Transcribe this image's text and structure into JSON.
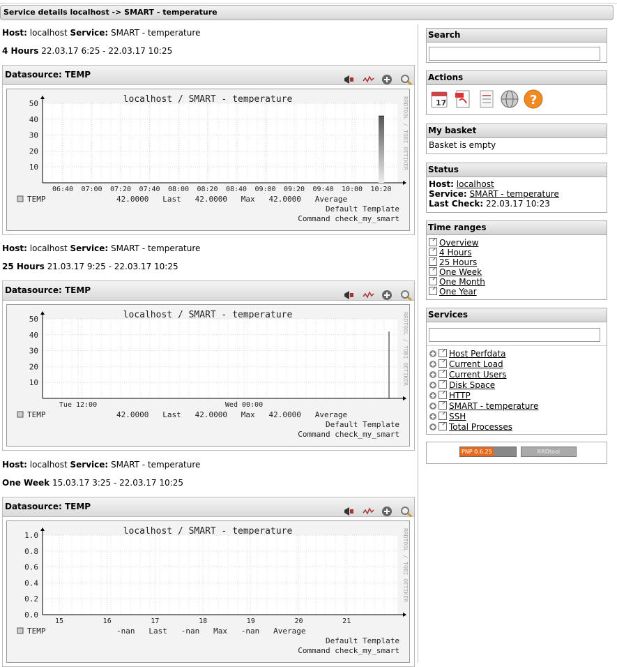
{
  "title": "Service details localhost -> SMART - temperature",
  "labels": {
    "host": "Host:",
    "service": "Service:"
  },
  "host_name": "localhost",
  "service_name": "SMART - temperature",
  "periods": [
    {
      "range_label": "4 Hours",
      "range_value": "22.03.17 6:25 - 22.03.17 10:25",
      "datasource": "Datasource: TEMP",
      "graph_title": "localhost / SMART - temperature",
      "side_text": "RRDTOOL / TOBI OETIKER",
      "y_ticks": [
        "50",
        "40",
        "30",
        "20",
        "10"
      ],
      "x_ticks": [
        "06:40",
        "07:00",
        "07:20",
        "07:40",
        "08:00",
        "08:20",
        "08:40",
        "09:00",
        "09:20",
        "09:40",
        "10:00",
        "10:20"
      ],
      "legend_name": "TEMP",
      "legend_stats": "42.0000   Last   42.0000   Max   42.0000   Average",
      "template_line": "Default Template",
      "command_line": "Command check_my_smart"
    },
    {
      "range_label": "25 Hours",
      "range_value": "21.03.17 9:25 - 22.03.17 10:25",
      "datasource": "Datasource: TEMP",
      "graph_title": "localhost / SMART - temperature",
      "side_text": "RRDTOOL / TOBI OETIKER",
      "y_ticks": [
        "50",
        "40",
        "30",
        "20",
        "10"
      ],
      "x_ticks": [
        "Tue 12:00",
        "Wed 00:00"
      ],
      "legend_name": "TEMP",
      "legend_stats": "42.0000   Last   42.0000   Max   42.0000   Average",
      "template_line": "Default Template",
      "command_line": "Command check_my_smart"
    },
    {
      "range_label": "One Week",
      "range_value": "15.03.17 3:25 - 22.03.17 10:25",
      "datasource": "Datasource: TEMP",
      "graph_title": "localhost / SMART - temperature",
      "side_text": "RRDTOOL / TOBI OETIKER",
      "y_ticks": [
        "1.0",
        "0.8",
        "0.6",
        "0.4",
        "0.2",
        "0.0"
      ],
      "x_ticks": [
        "15",
        "16",
        "17",
        "18",
        "19",
        "20",
        "21"
      ],
      "legend_name": "TEMP",
      "legend_stats": "-nan   Last   -nan   Max   -nan   Average",
      "template_line": "Default Template",
      "command_line": "Command check_my_smart"
    }
  ],
  "sidebar": {
    "search_title": "Search",
    "actions_title": "Actions",
    "action_icons": [
      "calendar-icon",
      "pdf-icon",
      "document-icon",
      "globe-icon",
      "help-icon"
    ],
    "basket_title": "My basket",
    "basket_text": "Basket is empty",
    "status_title": "Status",
    "status": {
      "host_label": "Host:",
      "host_value": "localhost",
      "service_label": "Service:",
      "service_value": "SMART - temperature",
      "check_label": "Last Check:",
      "check_value": "22.03.17 10:23"
    },
    "timeranges_title": "Time ranges",
    "timeranges": [
      "Overview",
      "4 Hours",
      "25 Hours",
      "One Week",
      "One Month",
      "One Year"
    ],
    "services_title": "Services",
    "services": [
      "Host Perfdata",
      "Current Load",
      "Current Users",
      "Disk Space",
      "HTTP",
      "SMART - temperature",
      "SSH",
      "Total Processes"
    ],
    "badges": [
      "PNP 0.6.25",
      "RRDtool"
    ]
  },
  "chart_data": [
    {
      "type": "area",
      "title": "localhost / SMART - temperature",
      "categories": [
        "06:40",
        "07:00",
        "07:20",
        "07:40",
        "08:00",
        "08:20",
        "08:40",
        "09:00",
        "09:20",
        "09:40",
        "10:00",
        "10:20"
      ],
      "series": [
        {
          "name": "TEMP",
          "values": [
            null,
            null,
            null,
            null,
            null,
            null,
            null,
            null,
            null,
            null,
            null,
            42
          ]
        }
      ],
      "ylim": [
        0,
        50
      ],
      "grid": true
    },
    {
      "type": "area",
      "title": "localhost / SMART - temperature",
      "categories": [
        "Tue 12:00",
        "Wed 00:00"
      ],
      "series": [
        {
          "name": "TEMP",
          "values": [
            null,
            42
          ]
        }
      ],
      "ylim": [
        0,
        50
      ],
      "grid": true
    },
    {
      "type": "area",
      "title": "localhost / SMART - temperature",
      "categories": [
        "15",
        "16",
        "17",
        "18",
        "19",
        "20",
        "21"
      ],
      "series": [
        {
          "name": "TEMP",
          "values": [
            null,
            null,
            null,
            null,
            null,
            null,
            null
          ]
        }
      ],
      "ylim": [
        0,
        1.0
      ],
      "grid": true
    }
  ]
}
